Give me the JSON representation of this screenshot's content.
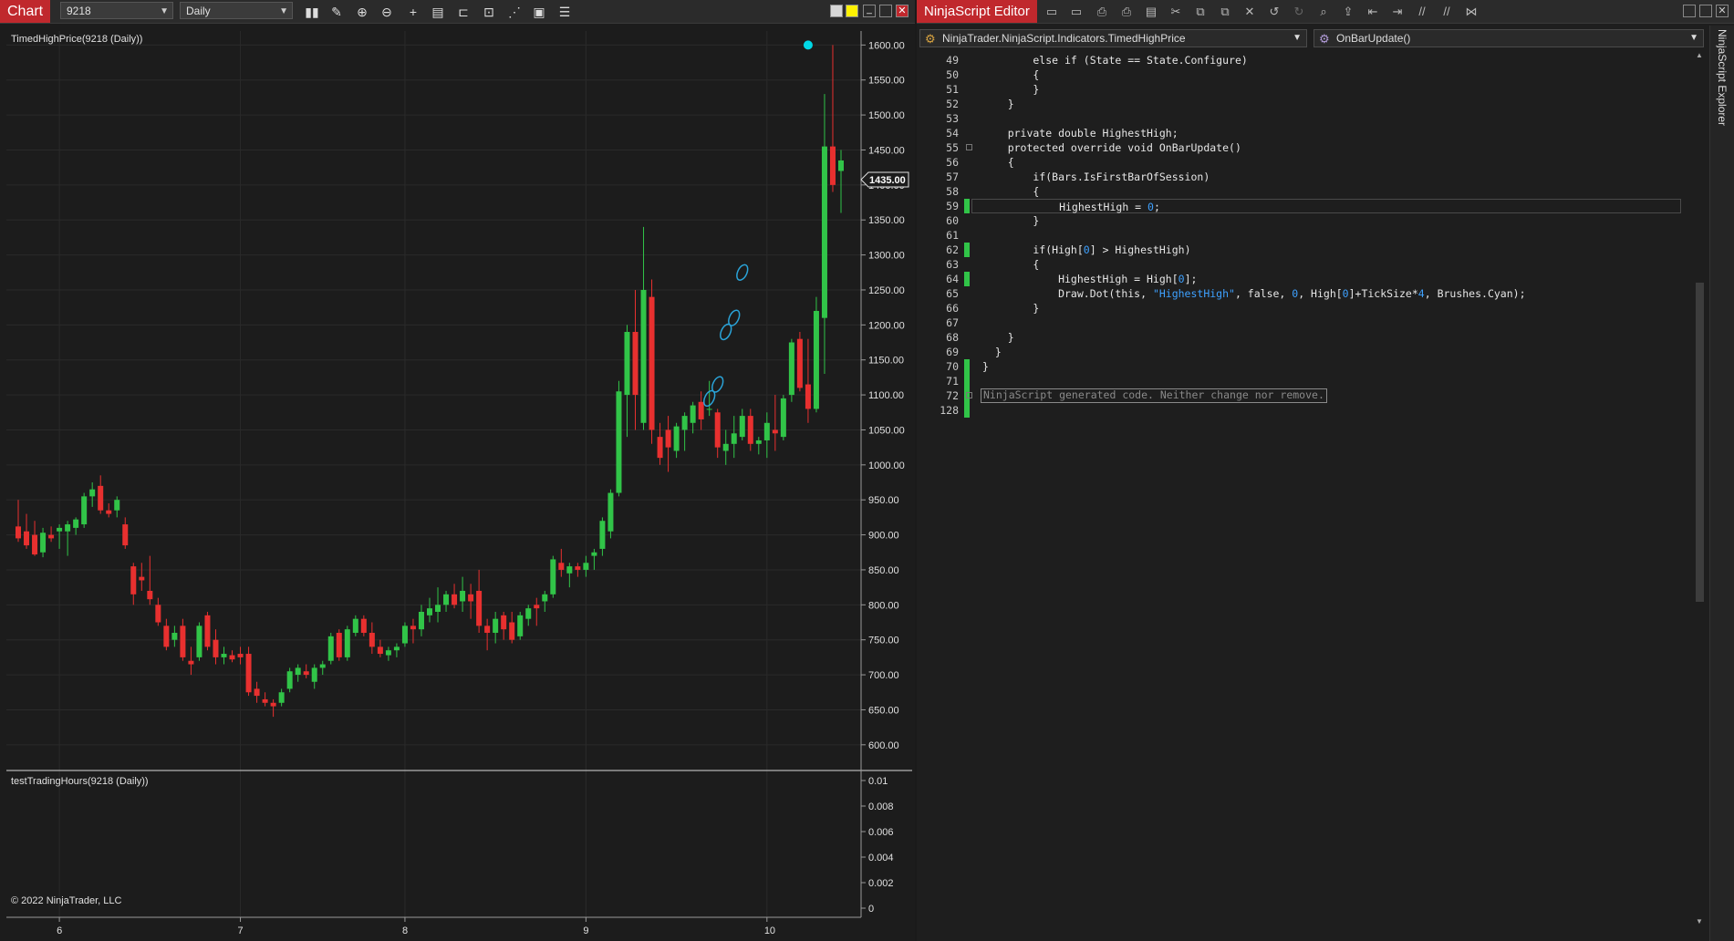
{
  "chart_window": {
    "tab_label": "Chart",
    "instrument": "9218",
    "period": "Daily",
    "toolbar_icons": [
      "bars-type-icon",
      "draw-tool-icon",
      "zoom-in-icon",
      "zoom-out-icon",
      "crosshair-icon",
      "data-box-icon",
      "properties-icon",
      "strategies-icon",
      "indicators-icon",
      "templates-icon",
      "more-icon"
    ],
    "window_colors": [
      "#d6d6d6",
      "#fff200"
    ],
    "close_color": "#c0282d"
  },
  "chart_data": [
    {
      "type": "candlestick",
      "title": "TimedHighPrice(9218 (Daily))",
      "ylim": [
        575,
        1620
      ],
      "y_ticks": [
        "1600.00",
        "1550.00",
        "1500.00",
        "1450.00",
        "1400.00",
        "1350.00",
        "1300.00",
        "1250.00",
        "1200.00",
        "1150.00",
        "1100.00",
        "1050.00",
        "1000.00",
        "950.00",
        "900.00",
        "850.00",
        "800.00",
        "750.00",
        "700.00",
        "650.00",
        "600.00"
      ],
      "last_price_label": "1435.00",
      "x_ticks": [
        "6",
        "7",
        "8",
        "9",
        "10"
      ],
      "up_color": "#31c448",
      "down_color": "#e8302f",
      "marker_color": "#00d8e6",
      "candles": [
        {
          "o": 912,
          "h": 950,
          "l": 890,
          "c": 895
        },
        {
          "o": 905,
          "h": 930,
          "l": 880,
          "c": 885
        },
        {
          "o": 900,
          "h": 920,
          "l": 870,
          "c": 872
        },
        {
          "o": 875,
          "h": 910,
          "l": 868,
          "c": 903
        },
        {
          "o": 900,
          "h": 912,
          "l": 890,
          "c": 895
        },
        {
          "o": 905,
          "h": 915,
          "l": 880,
          "c": 910
        },
        {
          "o": 905,
          "h": 920,
          "l": 870,
          "c": 915
        },
        {
          "o": 910,
          "h": 925,
          "l": 900,
          "c": 922
        },
        {
          "o": 915,
          "h": 960,
          "l": 910,
          "c": 955
        },
        {
          "o": 955,
          "h": 975,
          "l": 940,
          "c": 965
        },
        {
          "o": 970,
          "h": 985,
          "l": 930,
          "c": 935
        },
        {
          "o": 935,
          "h": 945,
          "l": 925,
          "c": 930
        },
        {
          "o": 935,
          "h": 955,
          "l": 925,
          "c": 950
        },
        {
          "o": 915,
          "h": 925,
          "l": 880,
          "c": 885
        },
        {
          "o": 855,
          "h": 860,
          "l": 800,
          "c": 815
        },
        {
          "o": 840,
          "h": 860,
          "l": 820,
          "c": 835
        },
        {
          "o": 820,
          "h": 870,
          "l": 800,
          "c": 808
        },
        {
          "o": 800,
          "h": 810,
          "l": 770,
          "c": 775
        },
        {
          "o": 770,
          "h": 780,
          "l": 735,
          "c": 740
        },
        {
          "o": 750,
          "h": 770,
          "l": 740,
          "c": 760
        },
        {
          "o": 770,
          "h": 780,
          "l": 720,
          "c": 725
        },
        {
          "o": 720,
          "h": 740,
          "l": 700,
          "c": 715
        },
        {
          "o": 725,
          "h": 775,
          "l": 720,
          "c": 770
        },
        {
          "o": 785,
          "h": 790,
          "l": 735,
          "c": 740
        },
        {
          "o": 750,
          "h": 765,
          "l": 715,
          "c": 725
        },
        {
          "o": 725,
          "h": 740,
          "l": 715,
          "c": 730
        },
        {
          "o": 728,
          "h": 735,
          "l": 718,
          "c": 722
        },
        {
          "o": 730,
          "h": 740,
          "l": 715,
          "c": 725
        },
        {
          "o": 730,
          "h": 740,
          "l": 670,
          "c": 675
        },
        {
          "o": 680,
          "h": 690,
          "l": 660,
          "c": 670
        },
        {
          "o": 665,
          "h": 675,
          "l": 655,
          "c": 660
        },
        {
          "o": 660,
          "h": 665,
          "l": 640,
          "c": 655
        },
        {
          "o": 660,
          "h": 680,
          "l": 655,
          "c": 675
        },
        {
          "o": 680,
          "h": 710,
          "l": 675,
          "c": 705
        },
        {
          "o": 700,
          "h": 715,
          "l": 690,
          "c": 710
        },
        {
          "o": 705,
          "h": 715,
          "l": 695,
          "c": 700
        },
        {
          "o": 690,
          "h": 715,
          "l": 680,
          "c": 710
        },
        {
          "o": 710,
          "h": 720,
          "l": 700,
          "c": 715
        },
        {
          "o": 720,
          "h": 760,
          "l": 715,
          "c": 755
        },
        {
          "o": 760,
          "h": 765,
          "l": 720,
          "c": 725
        },
        {
          "o": 725,
          "h": 770,
          "l": 720,
          "c": 765
        },
        {
          "o": 760,
          "h": 785,
          "l": 755,
          "c": 780
        },
        {
          "o": 780,
          "h": 785,
          "l": 755,
          "c": 760
        },
        {
          "o": 760,
          "h": 775,
          "l": 730,
          "c": 740
        },
        {
          "o": 740,
          "h": 750,
          "l": 725,
          "c": 730
        },
        {
          "o": 728,
          "h": 740,
          "l": 720,
          "c": 735
        },
        {
          "o": 735,
          "h": 745,
          "l": 725,
          "c": 740
        },
        {
          "o": 745,
          "h": 775,
          "l": 740,
          "c": 770
        },
        {
          "o": 770,
          "h": 780,
          "l": 745,
          "c": 765
        },
        {
          "o": 765,
          "h": 800,
          "l": 755,
          "c": 790
        },
        {
          "o": 785,
          "h": 810,
          "l": 775,
          "c": 795
        },
        {
          "o": 790,
          "h": 825,
          "l": 775,
          "c": 800
        },
        {
          "o": 800,
          "h": 820,
          "l": 790,
          "c": 815
        },
        {
          "o": 815,
          "h": 830,
          "l": 795,
          "c": 800
        },
        {
          "o": 805,
          "h": 840,
          "l": 790,
          "c": 820
        },
        {
          "o": 815,
          "h": 830,
          "l": 780,
          "c": 805
        },
        {
          "o": 820,
          "h": 850,
          "l": 760,
          "c": 770
        },
        {
          "o": 770,
          "h": 780,
          "l": 735,
          "c": 760
        },
        {
          "o": 760,
          "h": 790,
          "l": 745,
          "c": 780
        },
        {
          "o": 785,
          "h": 790,
          "l": 750,
          "c": 765
        },
        {
          "o": 775,
          "h": 790,
          "l": 745,
          "c": 750
        },
        {
          "o": 755,
          "h": 790,
          "l": 750,
          "c": 785
        },
        {
          "o": 780,
          "h": 800,
          "l": 770,
          "c": 795
        },
        {
          "o": 800,
          "h": 810,
          "l": 770,
          "c": 795
        },
        {
          "o": 805,
          "h": 820,
          "l": 790,
          "c": 815
        },
        {
          "o": 815,
          "h": 870,
          "l": 810,
          "c": 865
        },
        {
          "o": 860,
          "h": 880,
          "l": 840,
          "c": 850
        },
        {
          "o": 845,
          "h": 860,
          "l": 825,
          "c": 855
        },
        {
          "o": 855,
          "h": 860,
          "l": 840,
          "c": 850
        },
        {
          "o": 850,
          "h": 870,
          "l": 840,
          "c": 860
        },
        {
          "o": 870,
          "h": 880,
          "l": 850,
          "c": 875
        },
        {
          "o": 880,
          "h": 925,
          "l": 870,
          "c": 920
        },
        {
          "o": 905,
          "h": 965,
          "l": 895,
          "c": 960
        },
        {
          "o": 960,
          "h": 1120,
          "l": 955,
          "c": 1105
        },
        {
          "o": 1100,
          "h": 1200,
          "l": 1040,
          "c": 1190
        },
        {
          "o": 1190,
          "h": 1250,
          "l": 1050,
          "c": 1100
        },
        {
          "o": 1060,
          "h": 1340,
          "l": 1050,
          "c": 1250
        },
        {
          "o": 1240,
          "h": 1265,
          "l": 1030,
          "c": 1050
        },
        {
          "o": 1040,
          "h": 1060,
          "l": 1000,
          "c": 1010
        },
        {
          "o": 1050,
          "h": 1070,
          "l": 990,
          "c": 1025
        },
        {
          "o": 1020,
          "h": 1060,
          "l": 1010,
          "c": 1055
        },
        {
          "o": 1050,
          "h": 1075,
          "l": 1020,
          "c": 1070
        },
        {
          "o": 1060,
          "h": 1090,
          "l": 1045,
          "c": 1085
        },
        {
          "o": 1090,
          "h": 1105,
          "l": 1050,
          "c": 1065
        },
        {
          "o": 1080,
          "h": 1120,
          "l": 1070,
          "c": 1080
        },
        {
          "o": 1075,
          "h": 1080,
          "l": 1010,
          "c": 1025
        },
        {
          "o": 1020,
          "h": 1050,
          "l": 1000,
          "c": 1030
        },
        {
          "o": 1030,
          "h": 1070,
          "l": 1010,
          "c": 1045
        },
        {
          "o": 1040,
          "h": 1080,
          "l": 1035,
          "c": 1070
        },
        {
          "o": 1070,
          "h": 1080,
          "l": 1020,
          "c": 1030
        },
        {
          "o": 1030,
          "h": 1040,
          "l": 1015,
          "c": 1035
        },
        {
          "o": 1035,
          "h": 1075,
          "l": 1010,
          "c": 1060
        },
        {
          "o": 1050,
          "h": 1100,
          "l": 1020,
          "c": 1045
        },
        {
          "o": 1040,
          "h": 1100,
          "l": 1035,
          "c": 1095
        },
        {
          "o": 1100,
          "h": 1180,
          "l": 1090,
          "c": 1175
        },
        {
          "o": 1180,
          "h": 1190,
          "l": 1105,
          "c": 1110
        },
        {
          "o": 1115,
          "h": 1180,
          "l": 1060,
          "c": 1080
        },
        {
          "o": 1080,
          "h": 1240,
          "l": 1075,
          "c": 1220
        },
        {
          "o": 1210,
          "h": 1530,
          "l": 1130,
          "c": 1455
        },
        {
          "o": 1455,
          "h": 1600,
          "l": 1390,
          "c": 1400
        },
        {
          "o": 1420,
          "h": 1450,
          "l": 1360,
          "c": 1435
        }
      ],
      "highest_high_dots": [
        {
          "i": 84,
          "v": 1095
        },
        {
          "i": 85,
          "v": 1115
        },
        {
          "i": 86,
          "v": 1190
        },
        {
          "i": 87,
          "v": 1210
        },
        {
          "i": 88,
          "v": 1275
        },
        {
          "i": 96,
          "v": 1600
        }
      ]
    },
    {
      "type": "line",
      "title": "testTradingHours(9218 (Daily))",
      "ylim": [
        0,
        0.01
      ],
      "y_ticks": [
        "0.01",
        "0.008",
        "0.006",
        "0.004",
        "0.002",
        "0"
      ]
    }
  ],
  "copyright": "© 2022 NinjaTrader, LLC",
  "editor": {
    "tab_label": "NinjaScript Editor",
    "class_selector": "NinjaTrader.NinjaScript.Indicators.TimedHighPrice",
    "member_selector": "OnBarUpdate()",
    "side_panel_label": "NinjaScript Explorer",
    "lines": [
      {
        "n": "49",
        "code": "        else if (State == State.Configure)",
        "mod": false
      },
      {
        "n": "50",
        "code": "        {",
        "mod": false
      },
      {
        "n": "51",
        "code": "        }",
        "mod": false
      },
      {
        "n": "52",
        "code": "    }",
        "mod": false
      },
      {
        "n": "53",
        "code": "",
        "mod": false
      },
      {
        "n": "54",
        "code": "    private double HighestHigh;",
        "mod": false
      },
      {
        "n": "55",
        "code": "    protected override void OnBarUpdate()",
        "mod": false
      },
      {
        "n": "56",
        "code": "    {",
        "mod": false
      },
      {
        "n": "57",
        "code": "        if(Bars.IsFirstBarOfSession)",
        "mod": false
      },
      {
        "n": "58",
        "code": "        {",
        "mod": false
      },
      {
        "n": "59",
        "code": "            HighestHigh = 0;",
        "mod": true
      },
      {
        "n": "60",
        "code": "        }",
        "mod": false
      },
      {
        "n": "61",
        "code": "",
        "mod": false
      },
      {
        "n": "62",
        "code": "        if(High[0] > HighestHigh)",
        "mod": true
      },
      {
        "n": "63",
        "code": "        {",
        "mod": false
      },
      {
        "n": "64",
        "code": "            HighestHigh = High[0];",
        "mod": true
      },
      {
        "n": "65",
        "code": "            Draw.Dot(this, \"HighestHigh\", false, 0, High[0]+TickSize*4, Brushes.Cyan);",
        "mod": false
      },
      {
        "n": "66",
        "code": "        }",
        "mod": false
      },
      {
        "n": "67",
        "code": "",
        "mod": false
      },
      {
        "n": "68",
        "code": "    }",
        "mod": false
      },
      {
        "n": "69",
        "code": "  }",
        "mod": false
      },
      {
        "n": "70",
        "code": "}",
        "mod": true
      },
      {
        "n": "71",
        "code": "",
        "mod": true
      },
      {
        "n": "72",
        "code": "NinjaScript generated code. Neither change nor remove.",
        "mod": true
      },
      {
        "n": "128",
        "code": "",
        "mod": true
      }
    ]
  }
}
